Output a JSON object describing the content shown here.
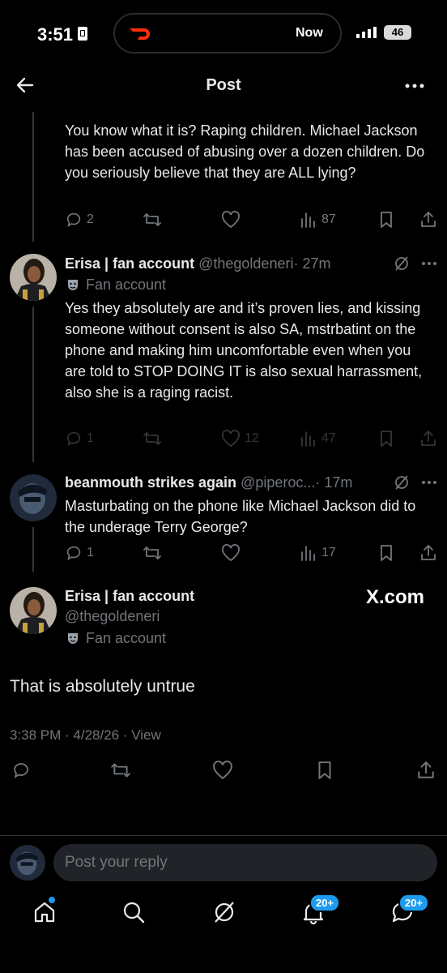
{
  "status_bar": {
    "time": "3:51",
    "activity_label": "Now",
    "battery": "46"
  },
  "header": {
    "title": "Post"
  },
  "parent_tweet": {
    "text": "You know what it is? Raping children. Michael Jackson has been accused of abusing over a dozen children. Do you seriously believe that they are ALL lying?",
    "replies": "2",
    "views": "87"
  },
  "reply_1": {
    "display_name": "Erisa | fan account",
    "handle": "@thegoldeneri",
    "time": "· 27m",
    "badge": "Fan account",
    "text": "Yes they absolutely are and it’s proven lies, and kissing someone without consent is also SA, mstrbatint on the phone and making him uncomfortable even when you are told to STOP DOING IT is also sexual harrassment, also she is a raging racist.",
    "replies": "1",
    "likes": "12",
    "views": "47"
  },
  "reply_2": {
    "display_name": "beanmouth strikes again",
    "handle": "@piperoc...",
    "time": "· 17m",
    "text": "Masturbating on the phone like Michael Jackson did to the underage Terry George?",
    "replies": "1",
    "views": "17"
  },
  "main_post": {
    "display_name": "Erisa | fan account",
    "handle": "@thegoldeneri",
    "badge": "Fan account",
    "watermark": "X.com",
    "text": "That is absolutely untrue",
    "meta": "3:38 PM · 4/28/26 · View"
  },
  "reply_box": {
    "placeholder": "Post your reply"
  },
  "bottom_nav": {
    "notifications_badge": "20+",
    "messages_badge": "20+"
  },
  "colors": {
    "background": "#000000",
    "text": "#e7e9ea",
    "secondary": "#71767b",
    "accent": "#1d9bf0"
  }
}
